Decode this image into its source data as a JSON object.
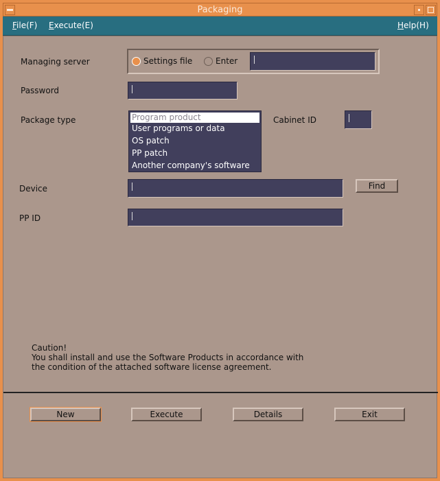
{
  "window": {
    "title": "Packaging"
  },
  "menu": [
    {
      "label": "File(F)",
      "mn": "F",
      "rest": "ile(F)"
    },
    {
      "label": "Execute(E)",
      "mn": "E",
      "rest": "xecute(E)"
    },
    {
      "label": "Help(H)",
      "mn": "H",
      "rest": "elp(H)"
    }
  ],
  "form": {
    "managing_server": {
      "label": "Managing server",
      "options": [
        "Settings file",
        "Enter"
      ],
      "selected": "Settings file",
      "value": ""
    },
    "password": {
      "label": "Password",
      "value": ""
    },
    "package_type": {
      "label": "Package type",
      "options": [
        "Program product",
        "User programs or data",
        "OS patch",
        "PP patch",
        "Another company's software"
      ],
      "selected": "Program product"
    },
    "cabinet_id": {
      "label": "Cabinet ID",
      "value": ""
    },
    "device": {
      "label": "Device",
      "value": "",
      "find_label": "Find"
    },
    "pp_id": {
      "label": "PP ID",
      "value": ""
    }
  },
  "caution": [
    "Caution!",
    "You shall install and use the Software Products in accordance with",
    "the condition of the attached software license agreement."
  ],
  "buttons": {
    "new": "New",
    "execute": "Execute",
    "details": "Details",
    "exit": "Exit"
  },
  "colors": {
    "accent": "#e8904c",
    "menubar": "#286e80",
    "background": "#ab978c",
    "field": "#413f5c"
  }
}
